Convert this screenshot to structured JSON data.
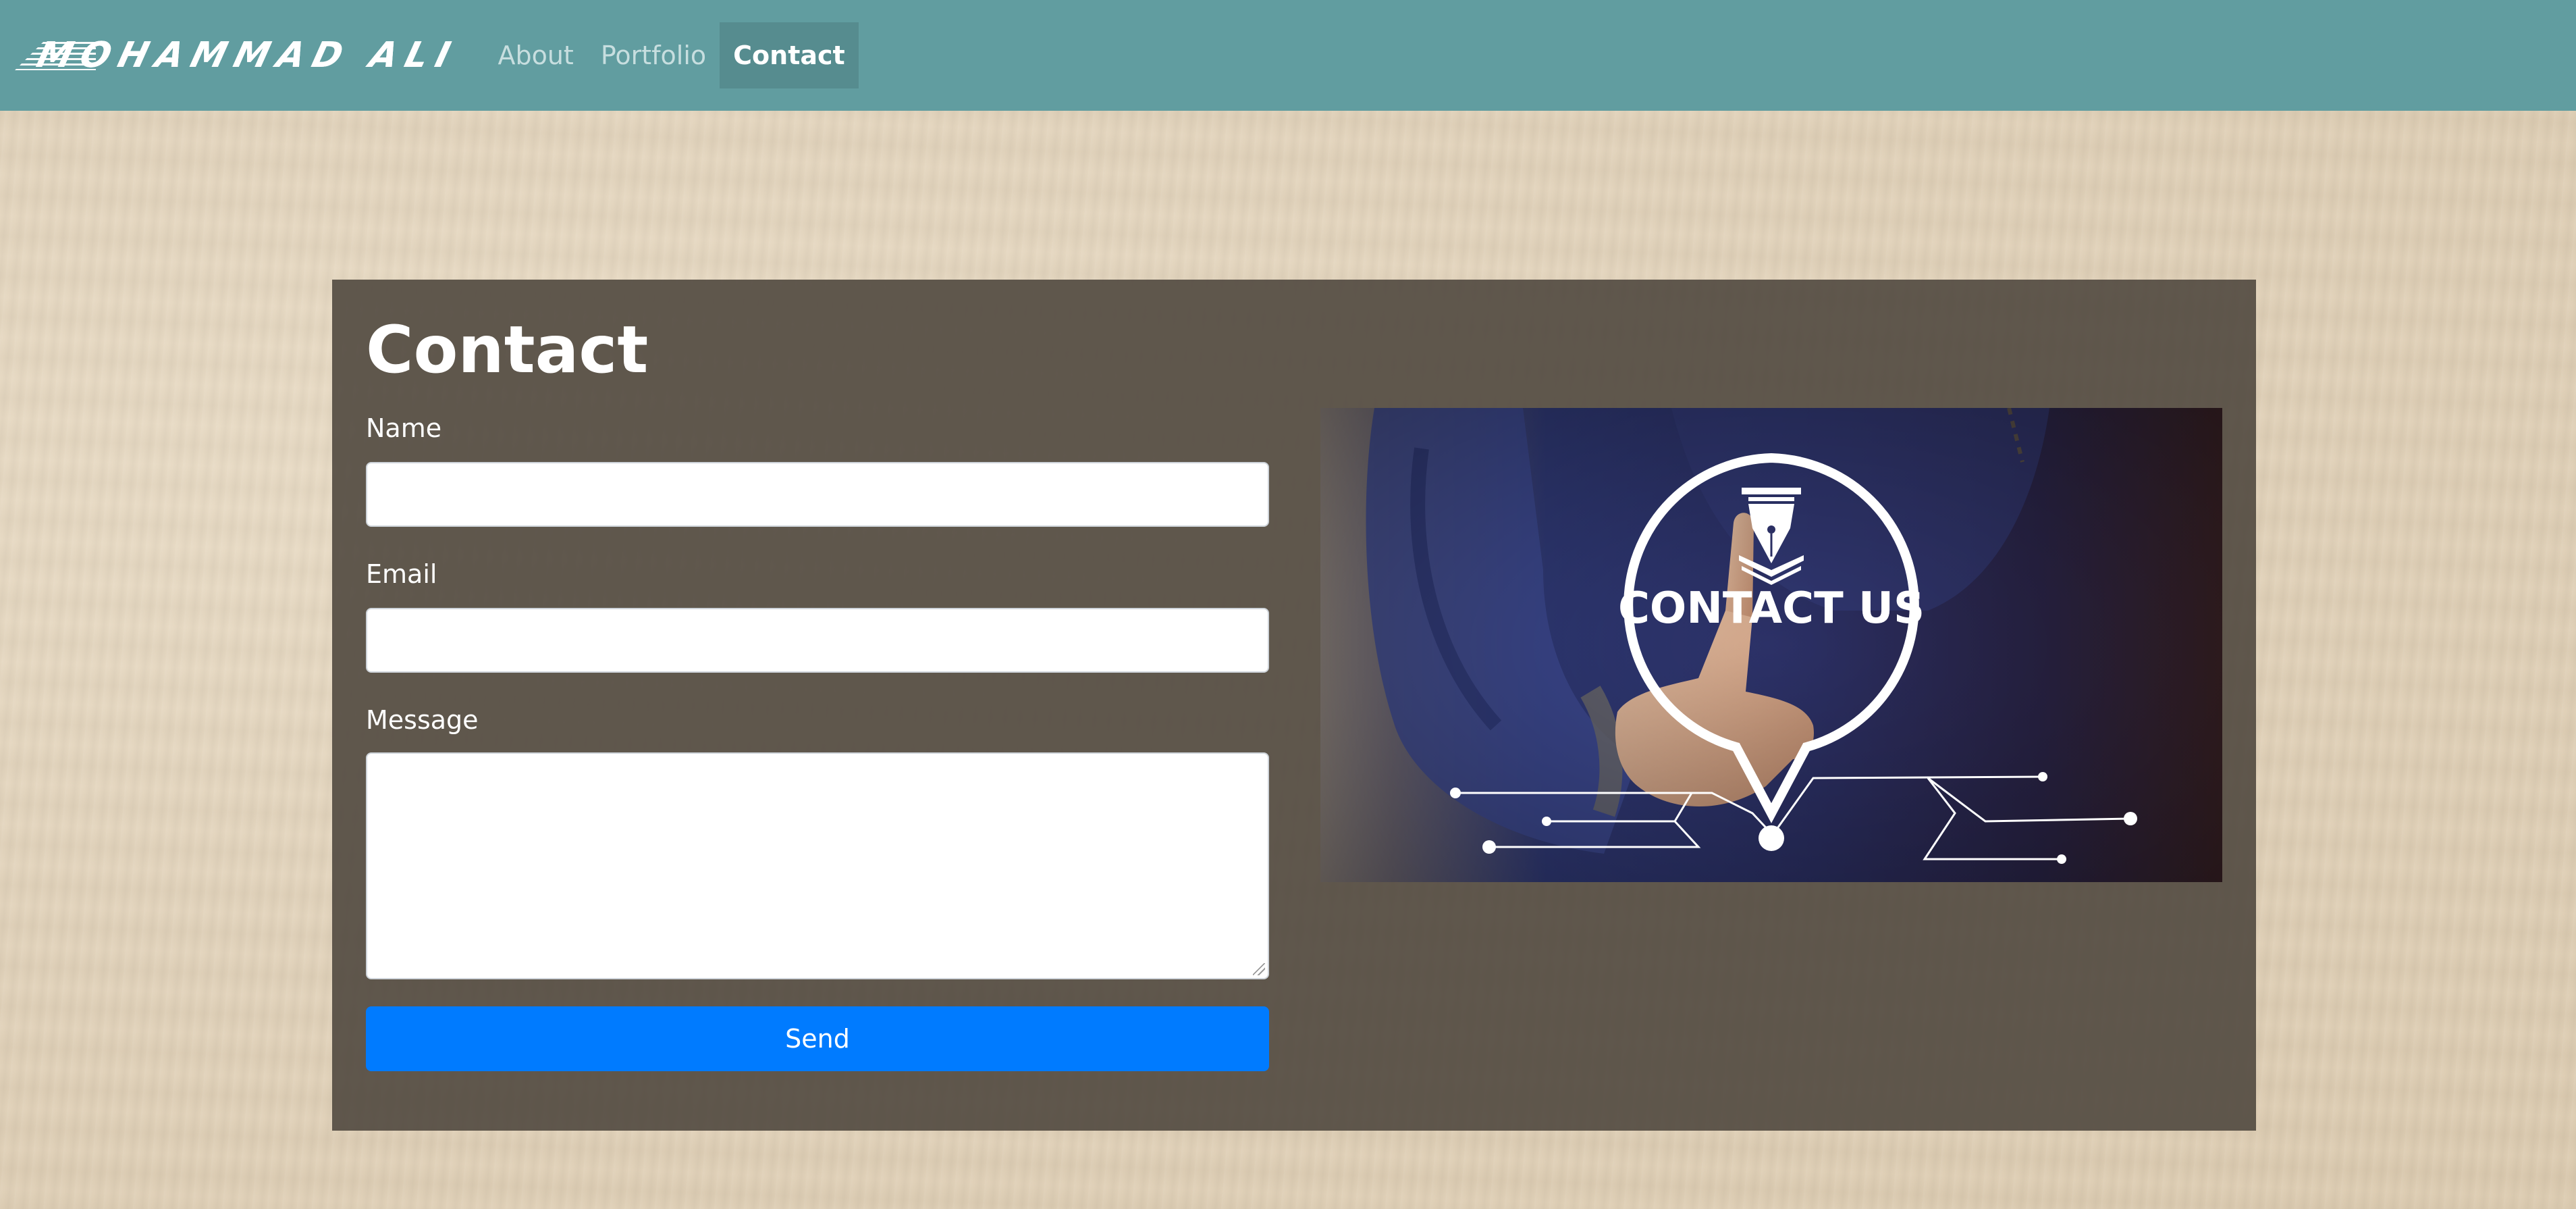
{
  "navbar": {
    "brand": "Mohammad Ali",
    "links": [
      {
        "label": "About",
        "active": false
      },
      {
        "label": "Portfolio",
        "active": false
      },
      {
        "label": "Contact",
        "active": true
      }
    ]
  },
  "contact": {
    "title": "Contact",
    "name_label": "Name",
    "name_value": "",
    "email_label": "Email",
    "email_value": "",
    "message_label": "Message",
    "message_value": "",
    "send_label": "Send",
    "image_text": "CONTACT US"
  },
  "colors": {
    "navbar_bg": "#619da0",
    "nav_active_bg": "#568c8f",
    "card_bg": "#544c42",
    "send_button": "#007bff",
    "page_bg": "#e2d3bb"
  }
}
